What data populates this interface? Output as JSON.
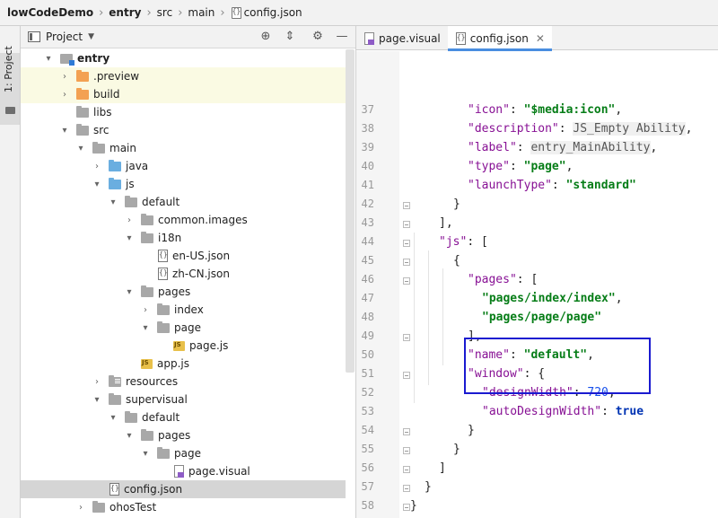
{
  "breadcrumb": {
    "items": [
      "lowCodeDemo",
      "entry",
      "src",
      "main",
      "config.json"
    ]
  },
  "left_strip": {
    "label": "1: Project"
  },
  "project_panel": {
    "title": "Project",
    "tree": [
      {
        "label": "entry",
        "arrow": "▾",
        "icon": "module",
        "depth": 1,
        "bold": true
      },
      {
        "label": ".preview",
        "arrow": "›",
        "icon": "orange",
        "depth": 2,
        "highlight": true
      },
      {
        "label": "build",
        "arrow": "›",
        "icon": "orange",
        "depth": 2,
        "highlight": true
      },
      {
        "label": "libs",
        "arrow": "",
        "icon": "grey",
        "depth": 2
      },
      {
        "label": "src",
        "arrow": "▾",
        "icon": "grey",
        "depth": 2
      },
      {
        "label": "main",
        "arrow": "▾",
        "icon": "grey",
        "depth": 3
      },
      {
        "label": "java",
        "arrow": "›",
        "icon": "blue",
        "depth": 4
      },
      {
        "label": "js",
        "arrow": "▾",
        "icon": "blue",
        "depth": 4
      },
      {
        "label": "default",
        "arrow": "▾",
        "icon": "grey",
        "depth": 5
      },
      {
        "label": "common.images",
        "arrow": "›",
        "icon": "grey",
        "depth": 6
      },
      {
        "label": "i18n",
        "arrow": "▾",
        "icon": "grey",
        "depth": 6
      },
      {
        "label": "en-US.json",
        "arrow": "",
        "icon": "json",
        "depth": 7
      },
      {
        "label": "zh-CN.json",
        "arrow": "",
        "icon": "json",
        "depth": 7
      },
      {
        "label": "pages",
        "arrow": "▾",
        "icon": "grey",
        "depth": 6
      },
      {
        "label": "index",
        "arrow": "›",
        "icon": "grey",
        "depth": 7
      },
      {
        "label": "page",
        "arrow": "▾",
        "icon": "grey",
        "depth": 7
      },
      {
        "label": "page.js",
        "arrow": "",
        "icon": "js",
        "depth": 8
      },
      {
        "label": "app.js",
        "arrow": "",
        "icon": "js",
        "depth": 6
      },
      {
        "label": "resources",
        "arrow": "›",
        "icon": "res",
        "depth": 4
      },
      {
        "label": "supervisual",
        "arrow": "▾",
        "icon": "grey",
        "depth": 4
      },
      {
        "label": "default",
        "arrow": "▾",
        "icon": "grey",
        "depth": 5
      },
      {
        "label": "pages",
        "arrow": "▾",
        "icon": "grey",
        "depth": 6
      },
      {
        "label": "page",
        "arrow": "▾",
        "icon": "grey",
        "depth": 7
      },
      {
        "label": "page.visual",
        "arrow": "",
        "icon": "visual",
        "depth": 8
      },
      {
        "label": "config.json",
        "arrow": "",
        "icon": "json",
        "depth": 4,
        "selected": true
      },
      {
        "label": "ohosTest",
        "arrow": "›",
        "icon": "grey",
        "depth": 3
      }
    ]
  },
  "editor": {
    "tabs": [
      {
        "label": "page.visual",
        "active": false
      },
      {
        "label": "config.json",
        "active": true
      }
    ],
    "line_numbers": [
      "37",
      "38",
      "39",
      "40",
      "41",
      "42",
      "43",
      "44",
      "45",
      "46",
      "47",
      "48",
      "49",
      "50",
      "51",
      "52",
      "53",
      "54",
      "55",
      "56",
      "57",
      "58"
    ],
    "lines": [
      "\"icon\": \"$media:icon\",",
      "\"description\": JS_Empty Ability,",
      "\"label\": entry_MainAbility,",
      "\"type\": \"page\",",
      "\"launchType\": \"standard\"",
      "}",
      "],",
      "\"js\": [",
      "{",
      "\"pages\": [",
      "\"pages/index/index\",",
      "\"pages/page/page\"",
      "],",
      "\"name\": \"default\",",
      "\"window\": {",
      "\"designWidth\": 720,",
      "\"autoDesignWidth\": true",
      "}",
      "}",
      "]",
      "}",
      "}"
    ]
  }
}
